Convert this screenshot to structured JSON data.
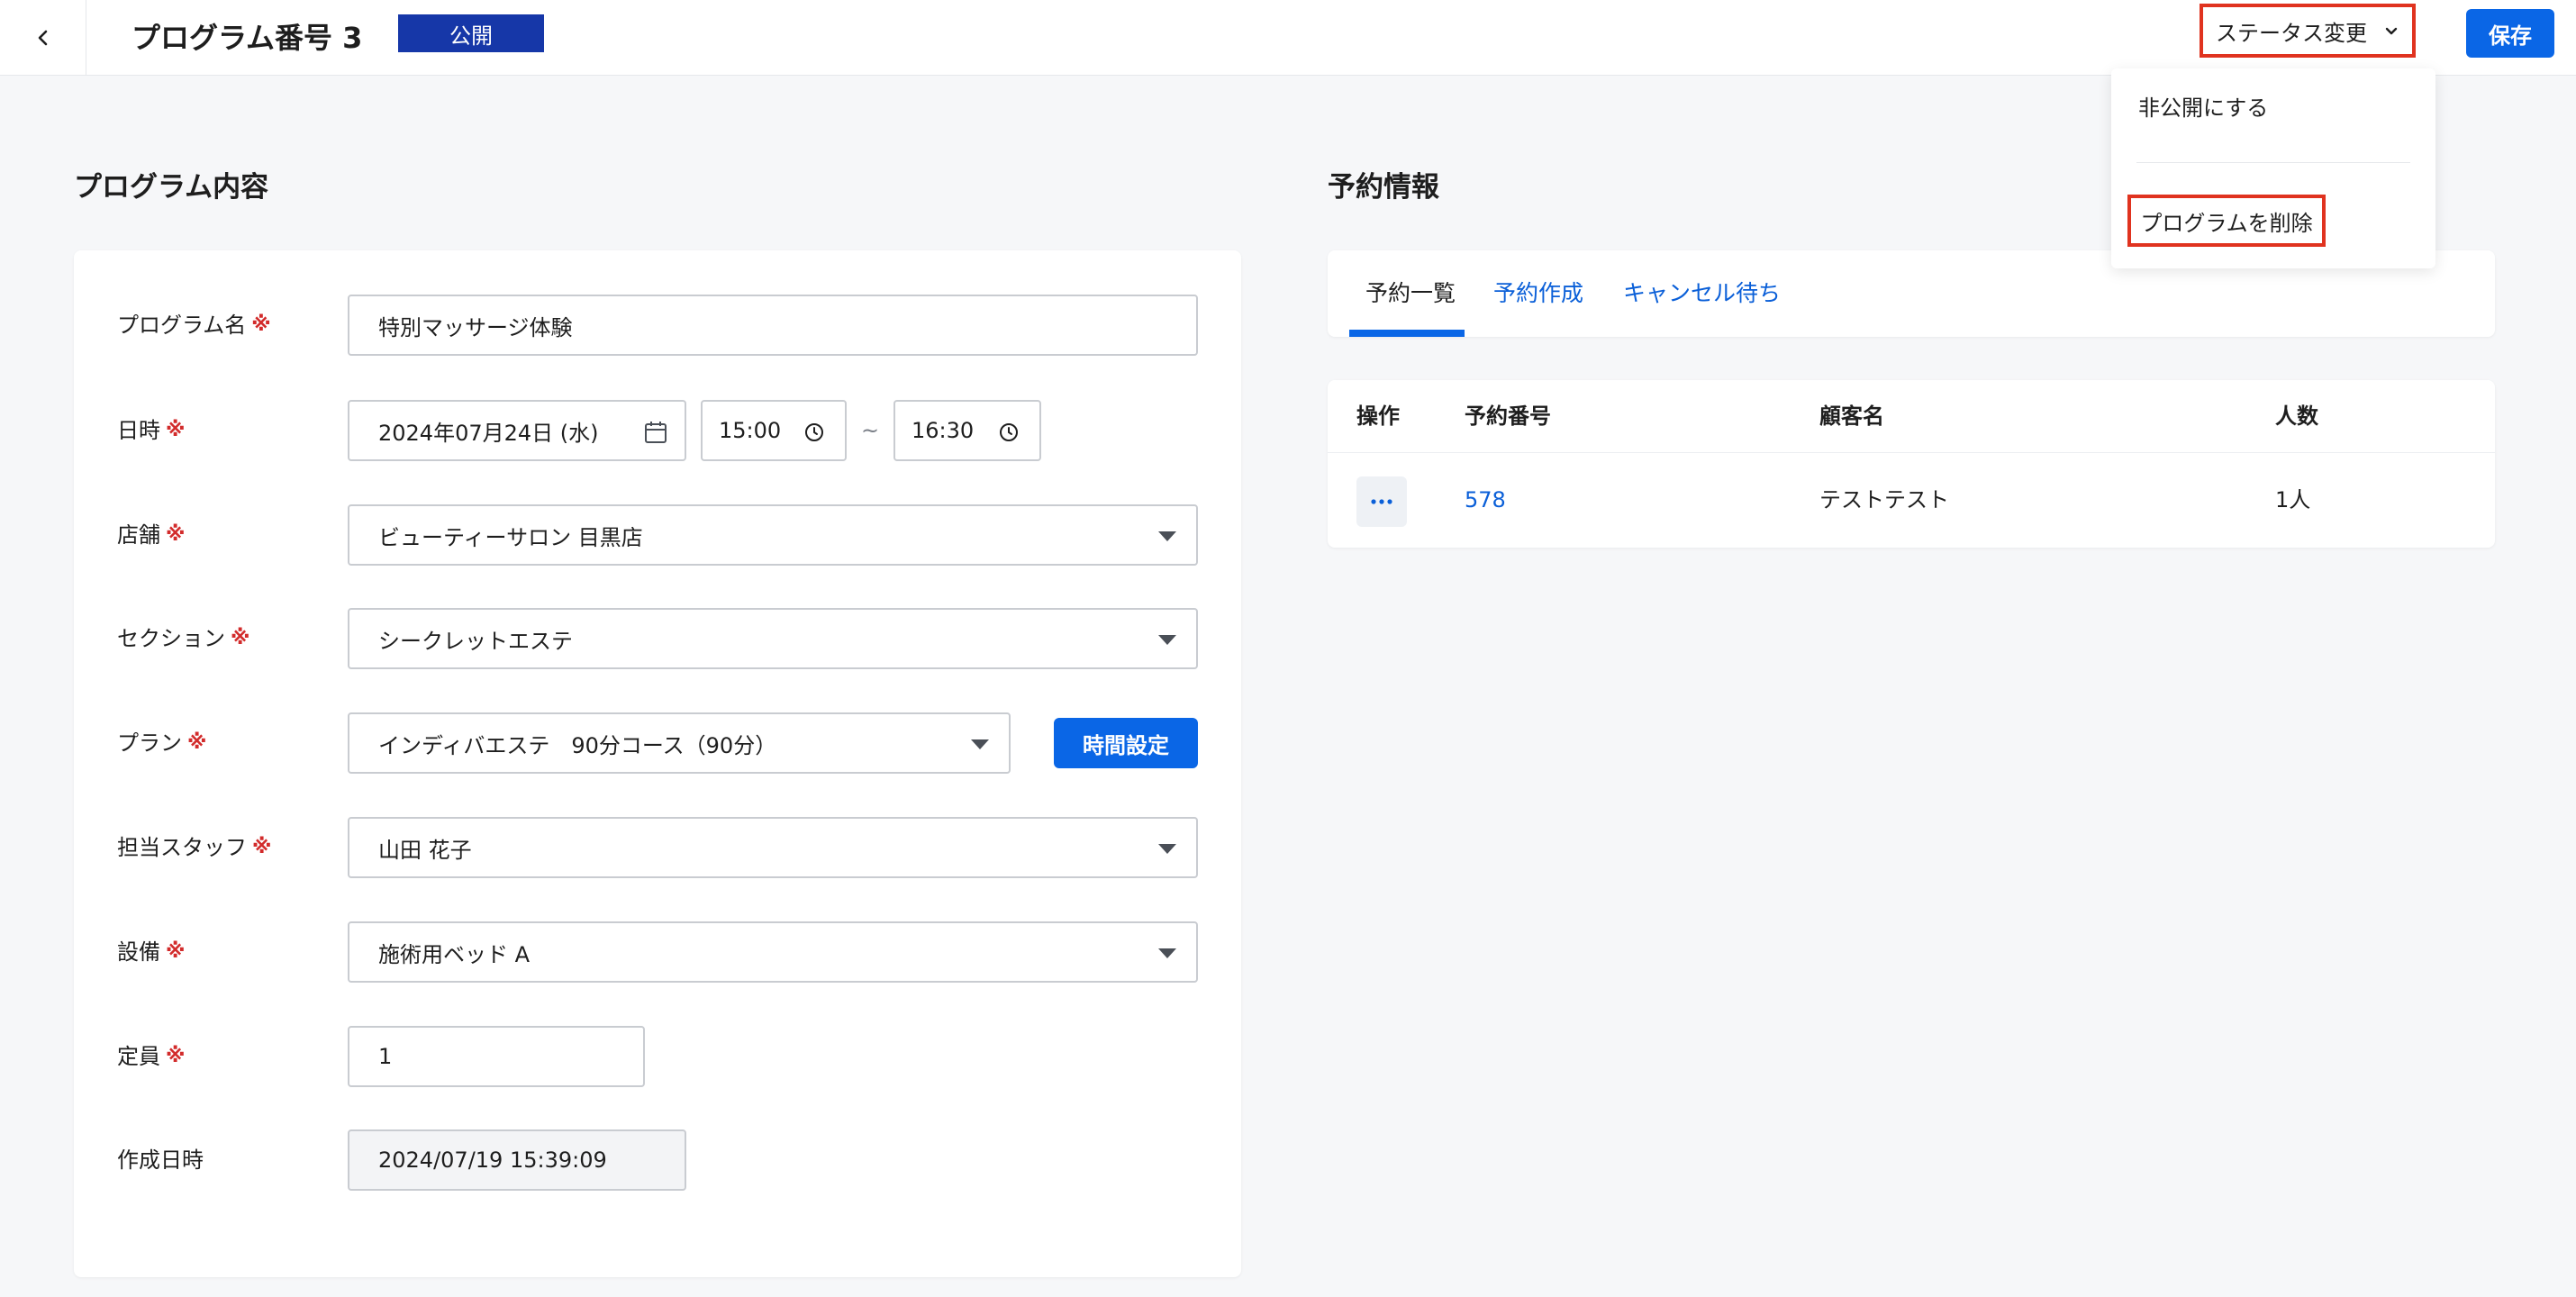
{
  "header": {
    "title": "プログラム番号 3",
    "status_badge": "公開",
    "status_change_label": "ステータス変更",
    "save_label": "保存"
  },
  "status_menu": {
    "unpublish_label": "非公開にする",
    "delete_label": "プログラムを削除"
  },
  "program": {
    "section_title": "プログラム内容",
    "required_mark": "※",
    "fields": {
      "name": {
        "label": "プログラム名",
        "value": "特別マッサージ体験"
      },
      "datetime": {
        "label": "日時",
        "date": "2024年07月24日 (水)",
        "start": "15:00",
        "separator": "~",
        "end": "16:30"
      },
      "store": {
        "label": "店舗",
        "value": "ビューティーサロン 目黒店"
      },
      "section": {
        "label": "セクション",
        "value": "シークレットエステ"
      },
      "plan": {
        "label": "プラン",
        "value": "インディバエステ　90分コース（90分）",
        "time_button": "時間設定"
      },
      "staff": {
        "label": "担当スタッフ",
        "value": "山田 花子"
      },
      "equipment": {
        "label": "設備",
        "value": "施術用ベッド A"
      },
      "capacity": {
        "label": "定員",
        "value": "1"
      },
      "created": {
        "label": "作成日時",
        "value": "2024/07/19 15:39:09"
      }
    }
  },
  "reservations": {
    "section_title": "予約情報",
    "tabs": [
      {
        "label": "予約一覧"
      },
      {
        "label": "予約作成"
      },
      {
        "label": "キャンセル待ち"
      }
    ],
    "columns": [
      "操作",
      "予約番号",
      "顧客名",
      "人数"
    ],
    "rows": [
      {
        "number": "578",
        "customer": "テストテスト",
        "count": "1人"
      }
    ]
  },
  "colors": {
    "accent": "#0a66e6",
    "badge": "#1637a8",
    "highlight_border": "#e0331f",
    "required": "#d22b2b"
  },
  "icons": [
    "chevron-left-icon",
    "chevron-down-icon",
    "calendar-icon",
    "clock-icon",
    "caret-down-icon",
    "more-horizontal-icon"
  ]
}
